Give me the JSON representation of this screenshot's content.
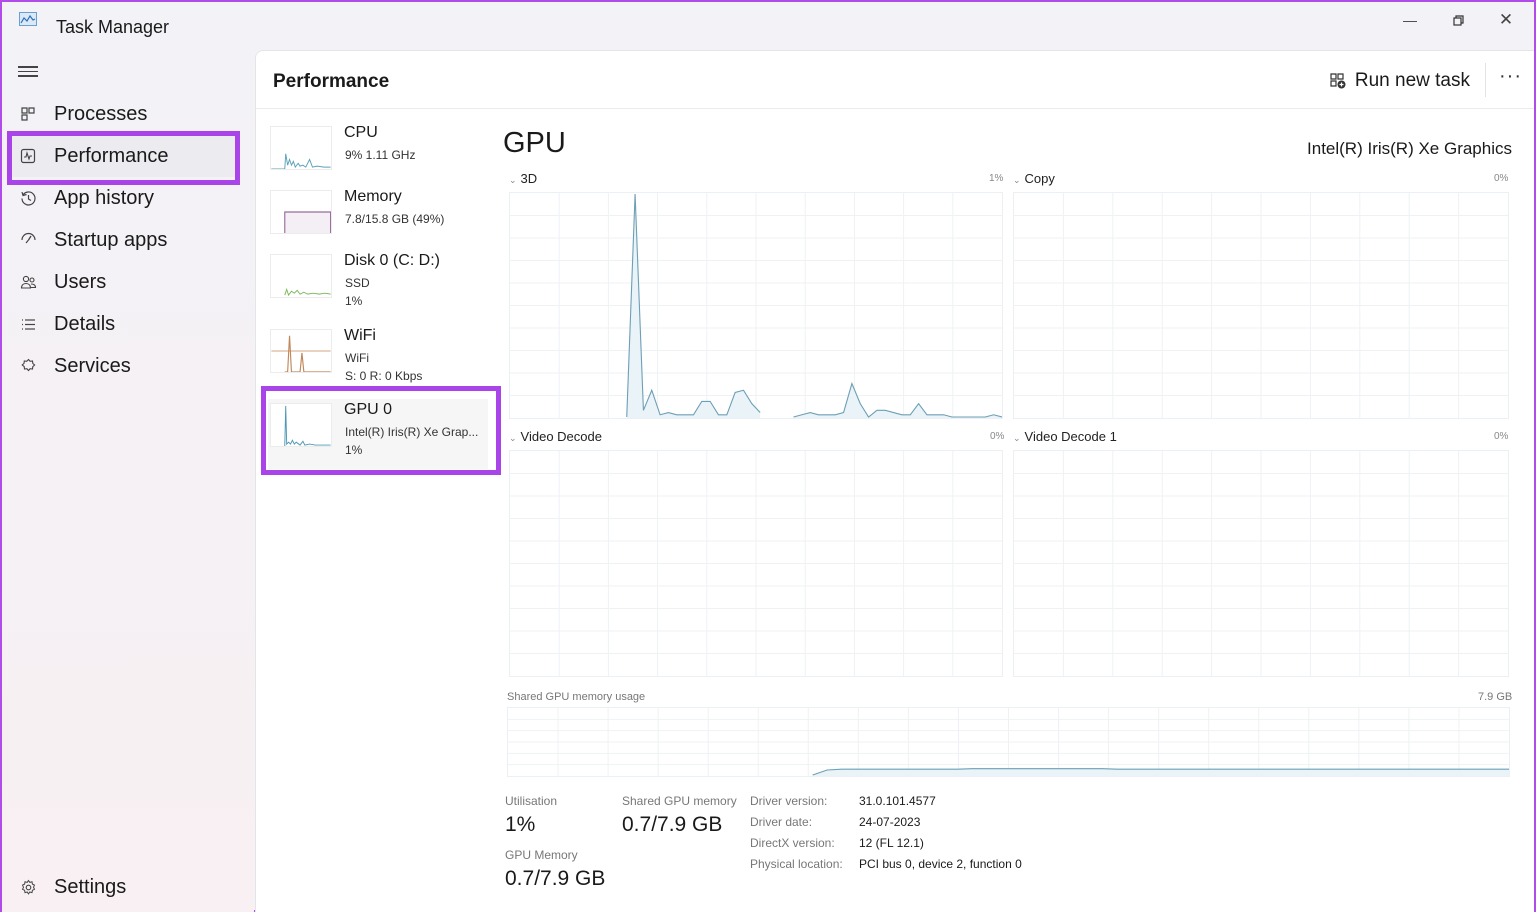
{
  "window": {
    "title": "Task Manager",
    "minimize_icon": "minimize-icon",
    "restore_icon": "restore-icon",
    "close_icon": "close-icon"
  },
  "sidebar": {
    "items": [
      {
        "label": "Processes",
        "icon": "processes-icon"
      },
      {
        "label": "Performance",
        "icon": "performance-icon",
        "active": true
      },
      {
        "label": "App history",
        "icon": "history-icon"
      },
      {
        "label": "Startup apps",
        "icon": "startup-icon"
      },
      {
        "label": "Users",
        "icon": "users-icon"
      },
      {
        "label": "Details",
        "icon": "details-icon"
      },
      {
        "label": "Services",
        "icon": "services-icon"
      }
    ],
    "settings": {
      "label": "Settings",
      "icon": "gear-icon"
    }
  },
  "header": {
    "title": "Performance",
    "run_new_task": "Run new task",
    "more": "···"
  },
  "resources": [
    {
      "name": "CPU",
      "line1": "9%  1.11 GHz",
      "color": "#5aa2b8"
    },
    {
      "name": "Memory",
      "line1": "7.8/15.8 GB (49%)",
      "color": "#9b6b9c"
    },
    {
      "name": "Disk 0 (C: D:)",
      "line1": "SSD",
      "line2": "1%",
      "color": "#7ab85a"
    },
    {
      "name": "WiFi",
      "line1": "WiFi",
      "line2": "S: 0  R: 0 Kbps",
      "color": "#c0875a"
    },
    {
      "name": "GPU 0",
      "line1": "Intel(R) Iris(R) Xe Grap...",
      "line2": "1%",
      "color": "#4f98b5",
      "selected": true
    }
  ],
  "gpu": {
    "title": "GPU",
    "model": "Intel(R) Iris(R) Xe Graphics",
    "engines": [
      {
        "label": "3D",
        "value": "1%"
      },
      {
        "label": "Copy",
        "value": "0%"
      },
      {
        "label": "Video Decode",
        "value": "0%"
      },
      {
        "label": "Video Decode 1",
        "value": "0%"
      }
    ],
    "shared_memory_graph": {
      "label": "Shared GPU memory usage",
      "max": "7.9 GB"
    },
    "stats": {
      "utilisation_label": "Utilisation",
      "utilisation_value": "1%",
      "shared_label": "Shared GPU memory",
      "shared_value": "0.7/7.9 GB",
      "gpu_mem_label": "GPU Memory",
      "gpu_mem_value": "0.7/7.9 GB"
    },
    "info": [
      {
        "label": "Driver version:",
        "value": "31.0.101.4577"
      },
      {
        "label": "Driver date:",
        "value": "24-07-2023"
      },
      {
        "label": "DirectX version:",
        "value": "12 (FL 12.1)"
      },
      {
        "label": "Physical location:",
        "value": "PCI bus 0, device 2, function 0"
      }
    ]
  },
  "chart_data": [
    {
      "type": "area",
      "title": "3D",
      "ylim": [
        0,
        100
      ],
      "x_points": 60,
      "values": [
        null,
        null,
        null,
        null,
        null,
        null,
        null,
        null,
        null,
        null,
        null,
        null,
        null,
        null,
        0,
        100,
        3,
        12,
        1,
        2,
        1,
        1,
        1,
        7,
        7,
        1,
        1,
        11,
        12,
        6,
        2,
        null,
        null,
        null,
        0,
        1,
        2,
        1,
        1,
        1,
        2,
        15,
        6,
        0,
        3,
        3,
        2,
        1,
        1,
        6,
        1,
        1,
        1,
        0,
        0,
        0,
        0,
        0,
        1,
        0
      ],
      "color": "#6d9fb5",
      "grid": true
    },
    {
      "type": "area",
      "title": "Copy",
      "ylim": [
        0,
        100
      ],
      "values": [],
      "grid": true
    },
    {
      "type": "area",
      "title": "Video Decode",
      "ylim": [
        0,
        100
      ],
      "values": [],
      "grid": true
    },
    {
      "type": "area",
      "title": "Video Decode 1",
      "ylim": [
        0,
        100
      ],
      "values": [],
      "grid": true
    },
    {
      "type": "area",
      "title": "Shared GPU memory usage",
      "ylim": [
        0,
        7.9
      ],
      "values": [
        null,
        null,
        null,
        null,
        null,
        null,
        null,
        null,
        null,
        null,
        null,
        null,
        null,
        null,
        null,
        null,
        null,
        null,
        null,
        null,
        null,
        0.0,
        0.6,
        0.7,
        0.7,
        0.7,
        0.7,
        0.7,
        0.7,
        0.7,
        0.7,
        0.7,
        0.75,
        0.75,
        0.75,
        0.75,
        0.75,
        0.75,
        0.75,
        0.75,
        0.75,
        0.75,
        0.7,
        0.7,
        0.7,
        0.7,
        0.7,
        0.7,
        0.7,
        0.7,
        0.7,
        0.7,
        0.7,
        0.7,
        0.7,
        0.7,
        0.7,
        0.7,
        0.7,
        0.7,
        0.7,
        0.7,
        0.7,
        0.7,
        0.7,
        0.7,
        0.7,
        0.7,
        0.7,
        0.7
      ],
      "color": "#6d9fb5",
      "grid": true
    }
  ]
}
